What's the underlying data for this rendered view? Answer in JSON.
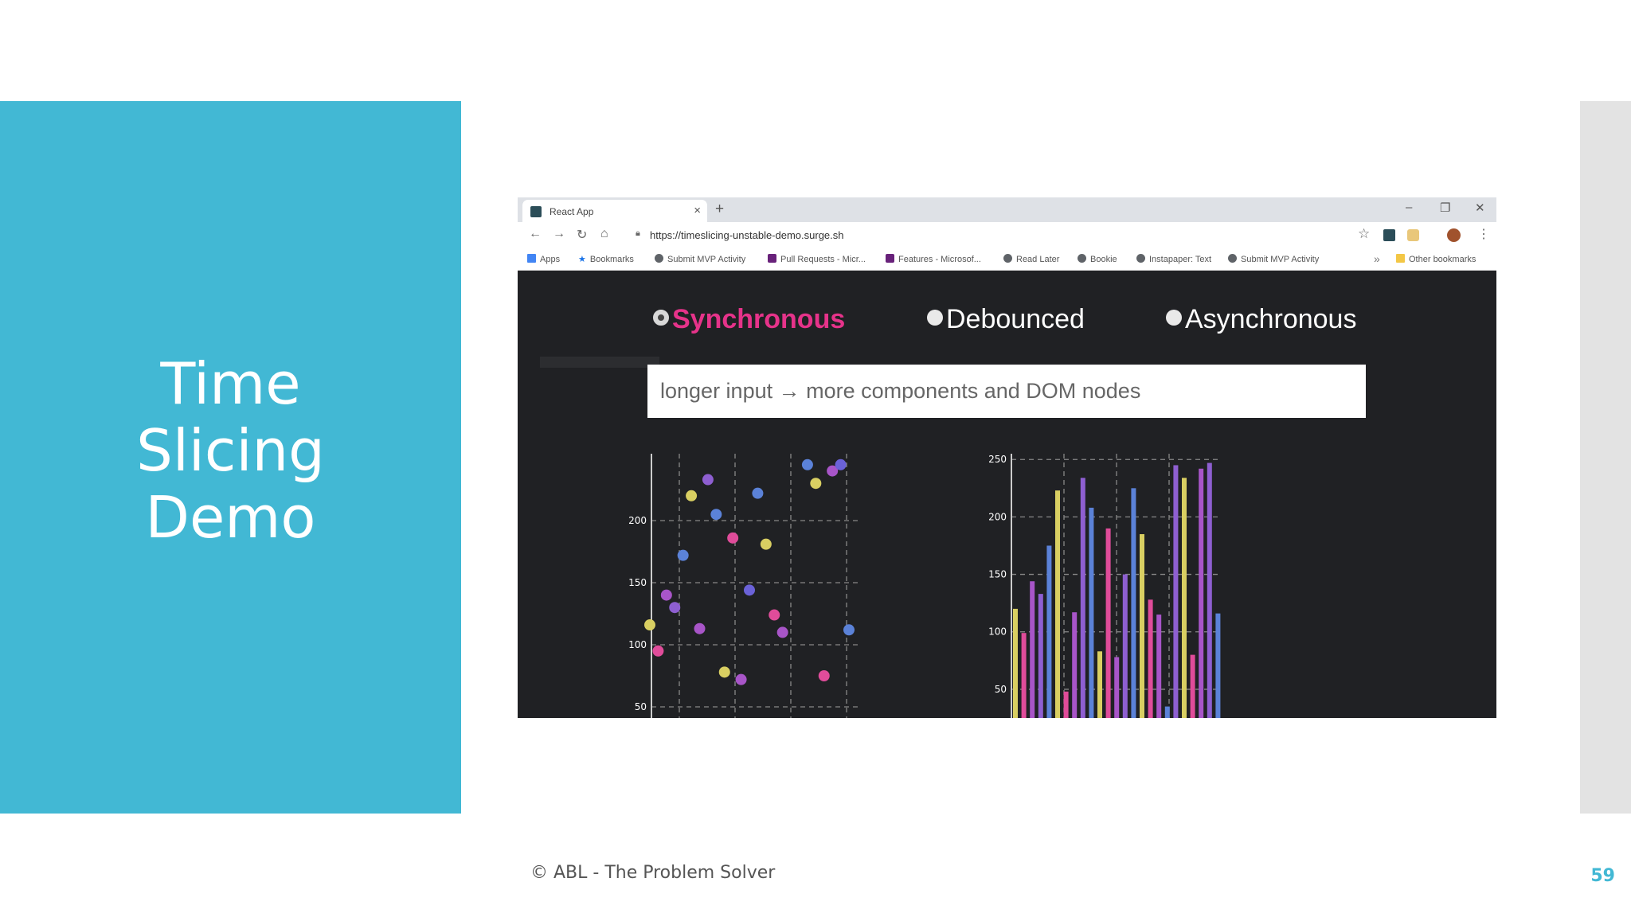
{
  "slide": {
    "title_lines": [
      "Time",
      "Slicing",
      "Demo"
    ],
    "footer": "© ABL - The Problem Solver",
    "page_number": "59"
  },
  "browser": {
    "tab": {
      "title": "React App",
      "close": "×",
      "favicon": "react-favicon"
    },
    "new_tab": "+",
    "window_controls": {
      "minimize": "–",
      "restore": "❐",
      "close": "✕"
    },
    "nav": {
      "back": "←",
      "forward": "→",
      "reload": "↻",
      "home": "⌂"
    },
    "url": "https://timeslicing-unstable-demo.surge.sh",
    "bookmarks": [
      {
        "label": "Apps",
        "icon": "apps-grid-icon"
      },
      {
        "label": "Bookmarks",
        "icon": "star-icon"
      },
      {
        "label": "Submit MVP Activity",
        "icon": "globe-icon"
      },
      {
        "label": "Pull Requests - Micr...",
        "icon": "visual-studio-icon"
      },
      {
        "label": "Features - Microsof...",
        "icon": "visual-studio-icon"
      },
      {
        "label": "Read Later",
        "icon": "globe-icon"
      },
      {
        "label": "Bookie",
        "icon": "globe-icon"
      },
      {
        "label": "Instapaper: Text",
        "icon": "globe-icon"
      },
      {
        "label": "Submit MVP Activity",
        "icon": "globe-icon"
      }
    ],
    "more_bookmarks": "»",
    "other_bookmarks": "Other bookmarks"
  },
  "app": {
    "options": [
      {
        "label": "Synchronous",
        "selected": true
      },
      {
        "label": "Debounced",
        "selected": false
      },
      {
        "label": "Asynchronous",
        "selected": false
      }
    ],
    "input_value": "longer input → more components and DOM nodes",
    "active_color": "#e6338a",
    "series_colors": [
      "#d9cf62",
      "#5b82d8",
      "#8e5fd1",
      "#e04c9a",
      "#a855c8",
      "#6b62d8"
    ]
  },
  "chart_data": [
    {
      "type": "scatter",
      "ylim": [
        50,
        250
      ],
      "yticks": [
        50,
        100,
        150,
        200
      ],
      "x_count": 24,
      "points": [
        {
          "x": 0,
          "y": 116,
          "c": 0
        },
        {
          "x": 1,
          "y": 95,
          "c": 3
        },
        {
          "x": 2,
          "y": 140,
          "c": 4
        },
        {
          "x": 3,
          "y": 130,
          "c": 2
        },
        {
          "x": 4,
          "y": 172,
          "c": 1
        },
        {
          "x": 5,
          "y": 220,
          "c": 0
        },
        {
          "x": 6,
          "y": 113,
          "c": 4
        },
        {
          "x": 7,
          "y": 233,
          "c": 2
        },
        {
          "x": 8,
          "y": 205,
          "c": 1
        },
        {
          "x": 9,
          "y": 78,
          "c": 0
        },
        {
          "x": 10,
          "y": 186,
          "c": 3
        },
        {
          "x": 11,
          "y": 72,
          "c": 4
        },
        {
          "x": 12,
          "y": 144,
          "c": 5
        },
        {
          "x": 13,
          "y": 222,
          "c": 1
        },
        {
          "x": 14,
          "y": 181,
          "c": 0
        },
        {
          "x": 15,
          "y": 124,
          "c": 3
        },
        {
          "x": 16,
          "y": 110,
          "c": 4
        },
        {
          "x": 19,
          "y": 245,
          "c": 1
        },
        {
          "x": 20,
          "y": 230,
          "c": 0
        },
        {
          "x": 21,
          "y": 75,
          "c": 3
        },
        {
          "x": 22,
          "y": 240,
          "c": 4
        },
        {
          "x": 23,
          "y": 245,
          "c": 5
        },
        {
          "x": 24,
          "y": 112,
          "c": 1
        }
      ]
    },
    {
      "type": "bar",
      "ylim": [
        25,
        255
      ],
      "yticks": [
        50,
        100,
        150,
        200,
        250
      ],
      "bars": [
        {
          "v": 120,
          "c": 0
        },
        {
          "v": 99,
          "c": 3
        },
        {
          "v": 144,
          "c": 4
        },
        {
          "v": 133,
          "c": 2
        },
        {
          "v": 175,
          "c": 1
        },
        {
          "v": 223,
          "c": 0
        },
        {
          "v": 48,
          "c": 3
        },
        {
          "v": 117,
          "c": 4
        },
        {
          "v": 234,
          "c": 2
        },
        {
          "v": 208,
          "c": 1
        },
        {
          "v": 83,
          "c": 0
        },
        {
          "v": 190,
          "c": 3
        },
        {
          "v": 78,
          "c": 4
        },
        {
          "v": 150,
          "c": 2
        },
        {
          "v": 225,
          "c": 1
        },
        {
          "v": 185,
          "c": 0
        },
        {
          "v": 128,
          "c": 3
        },
        {
          "v": 115,
          "c": 4
        },
        {
          "v": 35,
          "c": 1
        },
        {
          "v": 245,
          "c": 2
        },
        {
          "v": 234,
          "c": 0
        },
        {
          "v": 80,
          "c": 3
        },
        {
          "v": 242,
          "c": 4
        },
        {
          "v": 247,
          "c": 2
        },
        {
          "v": 116,
          "c": 1
        }
      ]
    }
  ]
}
